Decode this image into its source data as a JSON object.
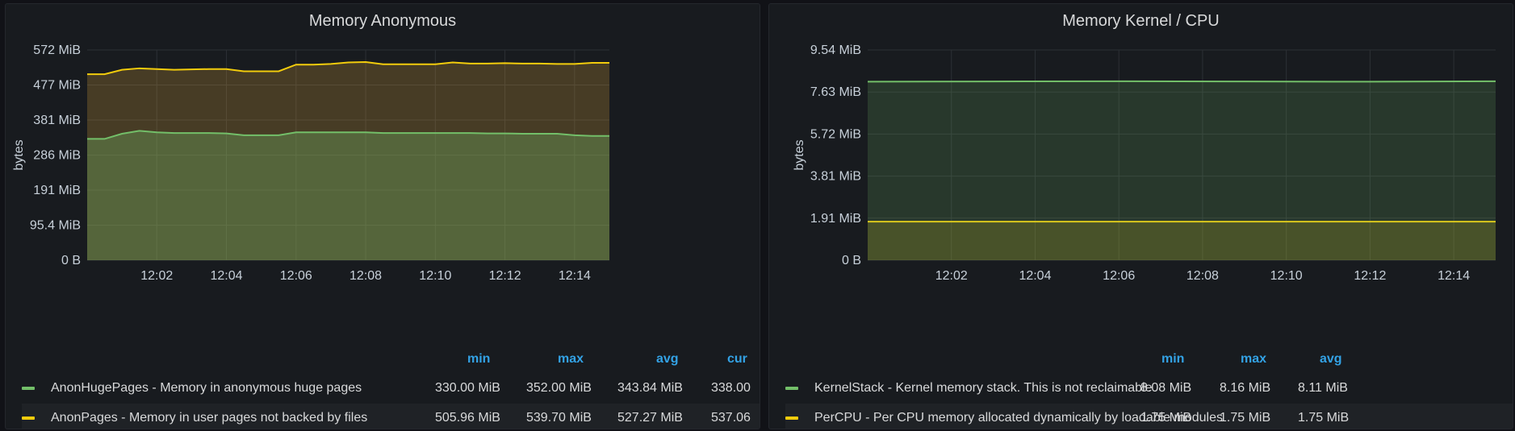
{
  "panels": [
    {
      "title": "Memory Anonymous",
      "legend_headers": [
        "min",
        "max",
        "avg",
        "cur"
      ],
      "legend": [
        {
          "name": "AnonHugePages - Memory in anonymous huge pages",
          "color": "#73bf69",
          "values": [
            "330.00 MiB",
            "352.00 MiB",
            "343.84 MiB",
            "338.00"
          ]
        },
        {
          "name": "AnonPages - Memory in user pages not backed by files",
          "color": "#f2cc0c",
          "values": [
            "505.96 MiB",
            "539.70 MiB",
            "527.27 MiB",
            "537.06"
          ]
        }
      ]
    },
    {
      "title": "Memory Kernel / CPU",
      "legend_headers": [
        "min",
        "max",
        "avg"
      ],
      "legend": [
        {
          "name": "KernelStack - Kernel memory stack. This is not reclaimable",
          "color": "#73bf69",
          "values": [
            "8.08 MiB",
            "8.16 MiB",
            "8.11 MiB"
          ]
        },
        {
          "name": "PerCPU - Per CPU memory allocated dynamically by loadable modules",
          "color": "#f2cc0c",
          "values": [
            "1.75 MiB",
            "1.75 MiB",
            "1.75 MiB"
          ]
        }
      ]
    }
  ],
  "chart_data": [
    {
      "type": "area",
      "title": "Memory Anonymous",
      "ylabel": "bytes",
      "y_ticks": [
        "0 B",
        "95.4 MiB",
        "191 MiB",
        "286 MiB",
        "381 MiB",
        "477 MiB",
        "572 MiB"
      ],
      "ylim": [
        0,
        572
      ],
      "y_unit": "MiB",
      "x_ticks": [
        "12:02",
        "12:04",
        "12:06",
        "12:08",
        "12:10",
        "12:12",
        "12:14"
      ],
      "x_range": [
        "12:00",
        "12:15"
      ],
      "grid": true,
      "stacked": true,
      "series": [
        {
          "name": "AnonHugePages - Memory in anonymous huge pages",
          "color": "#73bf69",
          "x": [
            "12:00",
            "12:00:30",
            "12:01",
            "12:01:30",
            "12:02",
            "12:02:30",
            "12:03",
            "12:03:30",
            "12:04",
            "12:04:30",
            "12:05",
            "12:05:30",
            "12:06",
            "12:06:30",
            "12:07",
            "12:07:30",
            "12:08",
            "12:08:30",
            "12:09",
            "12:09:30",
            "12:10",
            "12:10:30",
            "12:11",
            "12:11:30",
            "12:12",
            "12:12:30",
            "12:13",
            "12:13:30",
            "12:14",
            "12:14:30",
            "12:15"
          ],
          "values": [
            330,
            330,
            344,
            352,
            348,
            346,
            346,
            346,
            345,
            340,
            340,
            340,
            348,
            348,
            348,
            348,
            348,
            346,
            346,
            346,
            346,
            346,
            346,
            345,
            345,
            344,
            344,
            344,
            340,
            338,
            338
          ]
        },
        {
          "name": "AnonPages - Memory in user pages not backed by files",
          "color": "#f2cc0c",
          "x": [
            "12:00",
            "12:00:30",
            "12:01",
            "12:01:30",
            "12:02",
            "12:02:30",
            "12:03",
            "12:03:30",
            "12:04",
            "12:04:30",
            "12:05",
            "12:05:30",
            "12:06",
            "12:06:30",
            "12:07",
            "12:07:30",
            "12:08",
            "12:08:30",
            "12:09",
            "12:09:30",
            "12:10",
            "12:10:30",
            "12:11",
            "12:11:30",
            "12:12",
            "12:12:30",
            "12:13",
            "12:13:30",
            "12:14",
            "12:14:30",
            "12:15"
          ],
          "values": [
            506,
            506,
            518,
            522,
            520,
            518,
            519,
            520,
            520,
            514,
            514,
            514,
            532,
            532,
            534,
            538,
            539,
            533,
            533,
            533,
            533,
            538,
            535,
            535,
            536,
            535,
            535,
            534,
            534,
            537,
            537
          ]
        }
      ]
    },
    {
      "type": "area",
      "title": "Memory Kernel / CPU",
      "ylabel": "bytes",
      "y_ticks": [
        "0 B",
        "1.91 MiB",
        "3.81 MiB",
        "5.72 MiB",
        "7.63 MiB",
        "9.54 MiB"
      ],
      "ylim": [
        0,
        9.54
      ],
      "y_unit": "MiB",
      "x_ticks": [
        "12:02",
        "12:04",
        "12:06",
        "12:08",
        "12:10",
        "12:12",
        "12:14"
      ],
      "x_range": [
        "12:00",
        "12:15"
      ],
      "grid": true,
      "stacked": false,
      "series": [
        {
          "name": "KernelStack - Kernel memory stack. This is not reclaimable",
          "color": "#73bf69",
          "x": [
            "12:00",
            "12:03",
            "12:06",
            "12:09",
            "12:12",
            "12:15"
          ],
          "values": [
            8.1,
            8.11,
            8.12,
            8.11,
            8.1,
            8.12
          ]
        },
        {
          "name": "PerCPU - Per CPU memory allocated dynamically by loadable modules",
          "color": "#f2cc0c",
          "x": [
            "12:00",
            "12:03",
            "12:06",
            "12:09",
            "12:12",
            "12:15"
          ],
          "values": [
            1.75,
            1.75,
            1.75,
            1.75,
            1.75,
            1.75
          ]
        }
      ]
    }
  ]
}
